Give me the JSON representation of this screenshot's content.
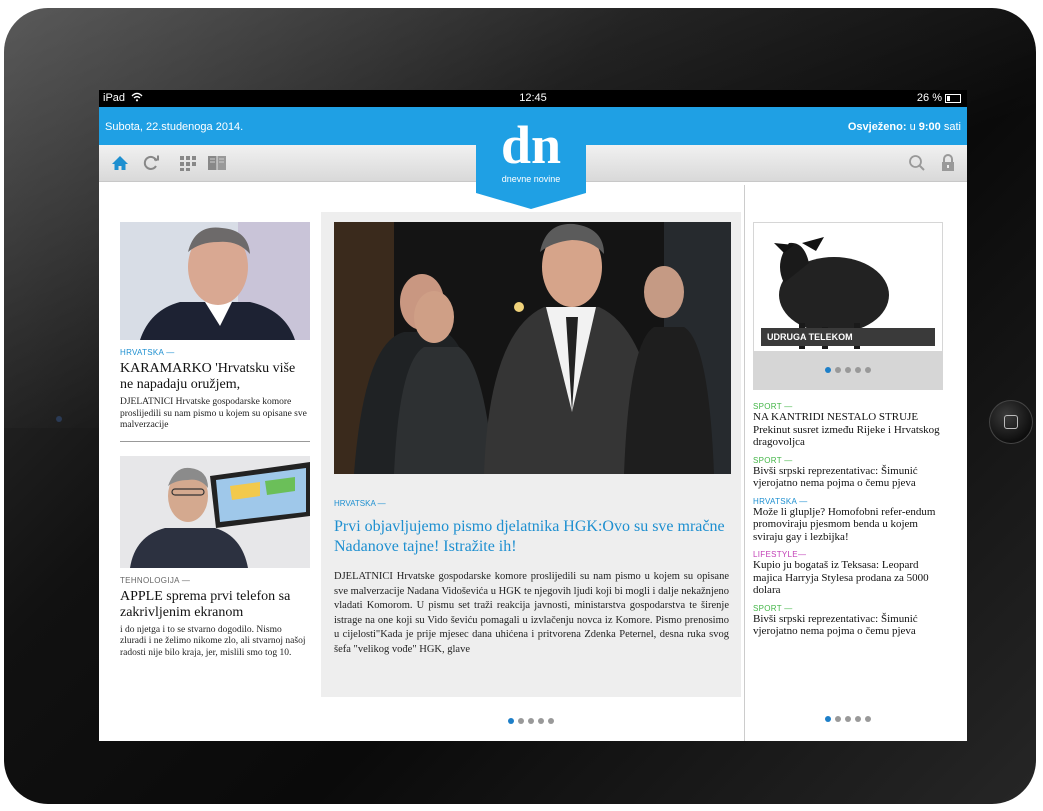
{
  "status_bar": {
    "device": "iPad",
    "time": "12:45",
    "battery": "26 %"
  },
  "header": {
    "date": "Subota, 22.studenoga 2014.",
    "updated_label": "Osvježeno:",
    "updated_in": "u",
    "updated_time": "9:00",
    "updated_suffix": "sati",
    "logo_text": "dn",
    "logo_subtitle": "dnevne novine"
  },
  "toolbar": {
    "icons": [
      "home-icon",
      "refresh-icon",
      "grid-icon",
      "book-icon",
      "search-icon",
      "lock-icon"
    ]
  },
  "left_column": {
    "articles": [
      {
        "section": "HRVATSKA —",
        "headline": "KARAMARKO 'Hrvatsku više ne napadaju oružjem,",
        "lead": "DJELATNICI Hrvatske gospodarske komore proslijedili su nam pismo u kojem su opisane sve malverzacije"
      },
      {
        "section": "TEHNOLOGIJA —",
        "headline": "APPLE sprema prvi telefon sa zakrivljenim ekranom",
        "lead": "i do njetga i to se stvarno dogodilo. Nismo zluradi i ne želimo nikome zlo, ali stvarnoj našoj radosti nije bilo kraja, jer, mislili smo tog 10."
      }
    ]
  },
  "main_article": {
    "section": "HRVATSKA —",
    "title": "Prvi objavljujemo pismo djelatnika HGK:Ovo su sve mračne Nadanove tajne! Istražite ih!",
    "body": "DJELATNICI Hrvatske gospodarske komore proslijedili su nam pismo u kojem su opisane sve malverzacije Nadana Vidoševića u HGK te njegovih ljudi koji bi mogli i dalje nekažnjeno vladati Komorom. U pismu set traži reakcija javnosti, ministarstva gospodarstva te širenje istrage na one koji su Vido ševiću pomagali u izvlačenju novca iz Komore. Pismo prenosimo u cijelosti\"Kada je prije mjesec dana uhićena i pritvorena Zdenka Peternel, desna ruka svog šefa \"velikog vođe\" HGK, glave",
    "pager": {
      "total": 5,
      "active": 0
    }
  },
  "right_column": {
    "ad": {
      "label": "UDRUGA TELEKOM",
      "pager": {
        "total": 5,
        "active": 0
      }
    },
    "news": [
      {
        "section": "SPORT —",
        "color": "#45b649",
        "text": "NA KANTRIDI NESTALO STRUJE Prekinut susret između Rijeke i Hrvatskog dragovoljca"
      },
      {
        "section": "SPORT —",
        "color": "#45b649",
        "text": "Bivši srpski reprezentativac: Šimunić vjerojatno nema pojma o čemu pjeva"
      },
      {
        "section": "HRVATSKA —",
        "color": "#1d8fd0",
        "text": "Može li gluplje? Homofobni refer-endum promoviraju pjesmom benda u kojem sviraju gay i lezbijka!"
      },
      {
        "section": "LIFESTYLE—",
        "color": "#c23fb6",
        "text": "Kupio ju bogataš iz Teksasa: Leopard majica Harryja Stylesa prodana za 5000 dolara"
      },
      {
        "section": "SPORT —",
        "color": "#45b649",
        "text": "Bivši srpski reprezentativac: Šimunić vjerojatno nema pojma o čemu pjeva"
      }
    ],
    "pager": {
      "total": 5,
      "active": 0
    }
  },
  "colors": {
    "accent": "#1fa0e4",
    "link": "#1d8fd0"
  }
}
